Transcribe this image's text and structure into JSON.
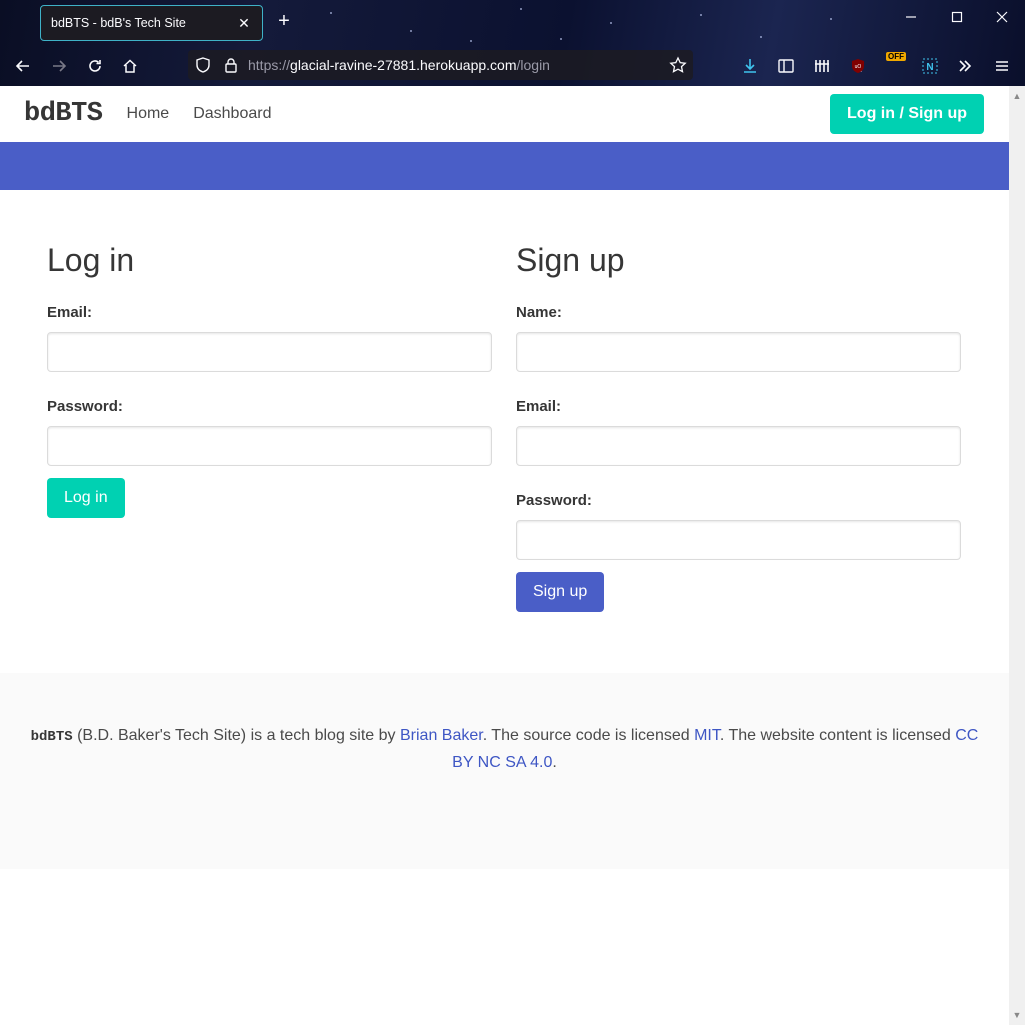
{
  "browser": {
    "tab_title": "bdBTS - bdB's Tech Site",
    "url_scheme": "https://",
    "url_host": "glacial-ravine-27881.herokuapp.com",
    "url_path": "/login",
    "ext_badge": "OFF"
  },
  "site": {
    "brand": "bdBTS",
    "nav": [
      "Home",
      "Dashboard"
    ],
    "auth_button": "Log in / Sign up",
    "hero_color": "#4a5ec7",
    "accent_color": "#00d1b2"
  },
  "login": {
    "heading": "Log in",
    "email_label": "Email:",
    "password_label": "Password:",
    "submit": "Log in"
  },
  "signup": {
    "heading": "Sign up",
    "name_label": "Name:",
    "email_label": "Email:",
    "password_label": "Password:",
    "submit": "Sign up"
  },
  "footer": {
    "brand": "bdBTS",
    "text1": " (B.D. Baker's Tech Site) is a tech blog site by ",
    "author_link": "Brian Baker",
    "text2": ". The source code is licensed ",
    "code_license": "MIT",
    "text3": ". The website content is licensed ",
    "content_license": "CC BY NC SA 4.0",
    "text4": "."
  }
}
